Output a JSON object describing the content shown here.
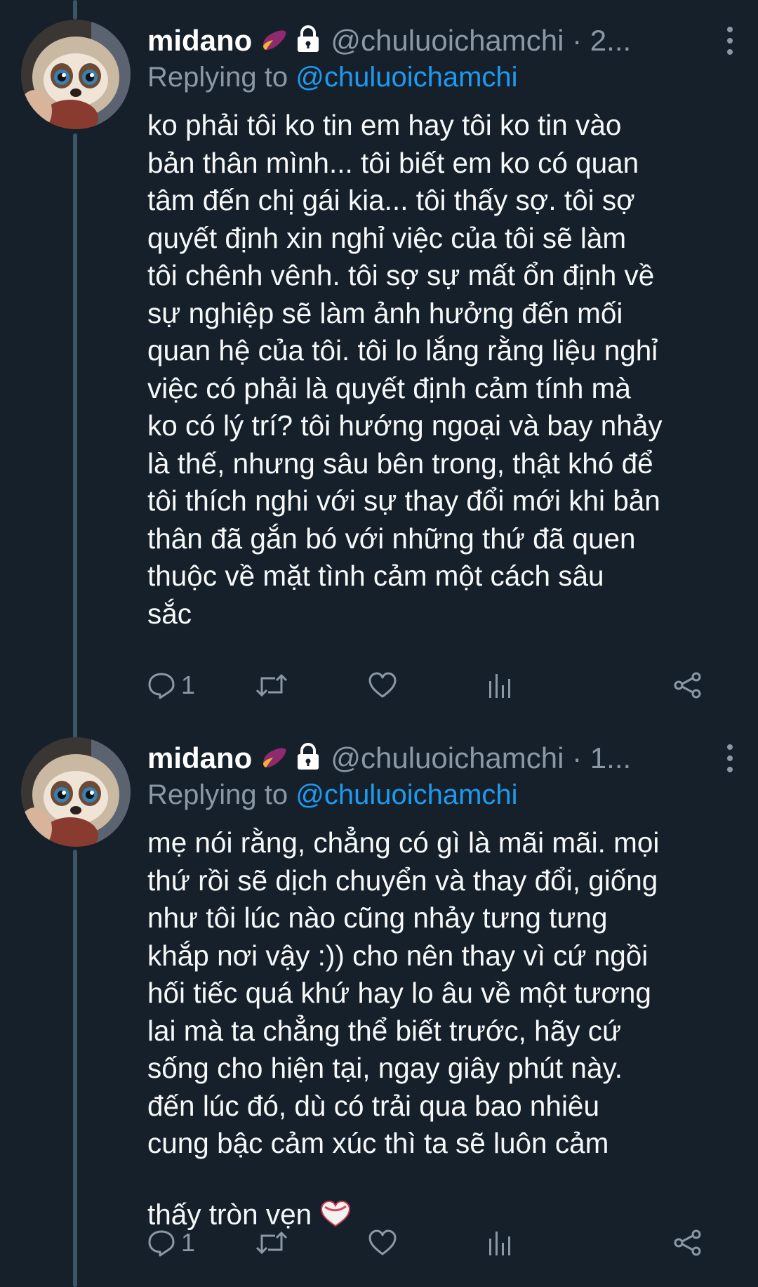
{
  "tweets": [
    {
      "name": "midano",
      "handle_time": "@chuluoichamchi · 2...",
      "replying_prefix": "Replying to ",
      "replying_to": "@chuluoichamchi",
      "text": "ko phải tôi ko tin em hay tôi ko tin vào\nbản thân mình... tôi biết em ko có quan\ntâm đến chị gái kia... tôi thấy sợ. tôi sợ\nquyết định xin nghỉ việc của tôi sẽ làm\ntôi chênh vênh. tôi sợ sự mất ổn định về\nsự nghiệp sẽ làm ảnh hưởng đến mối\nquan hệ của tôi. tôi lo lắng rằng liệu nghỉ\nviệc có phải là quyết định cảm tính mà\nko có lý trí? tôi hướng ngoại và bay nhảy\nlà thế, nhưng sâu bên trong, thật khó để\ntôi thích nghi với sự thay đổi mới khi bản\nthân đã gắn bó với những thứ đã quen\nthuộc về mặt tình cảm một cách sâu\nsắc",
      "reply_count": "1"
    },
    {
      "name": "midano",
      "handle_time": "@chuluoichamchi · 1...",
      "replying_prefix": "Replying to ",
      "replying_to": "@chuluoichamchi",
      "text": "mẹ nói rằng, chẳng có gì là mãi mãi. mọi\nthứ rồi sẽ dịch chuyển và thay đổi, giống\nnhư tôi lúc nào cũng nhảy tưng tưng\nkhắp nơi vậy :)) cho nên thay vì cứ ngồi\nhối tiếc quá khứ hay lo âu về một tương\nlai mà ta chẳng thể biết trước, hãy cứ\nsống cho hiện tại, ngay giây phút này.\nđến lúc đó, dù có trải qua bao nhiêu\ncung bậc cảm xúc thì ta sẽ luôn cảm\nthấy tròn vẹn",
      "reply_count": "1"
    }
  ],
  "icons": {
    "emoji": "sweet-potato-emoji",
    "lock": "lock-icon",
    "more": "more-vertical-icon",
    "reply": "reply-icon",
    "retweet": "retweet-icon",
    "like": "heart-icon",
    "analytics": "analytics-icon",
    "share": "share-icon",
    "heart_emoji": "white-heart-emoji"
  },
  "colors": {
    "background": "#15202b",
    "text": "#f7f9f9",
    "secondary": "#8b98a5",
    "link": "#1d9bf0",
    "thread_line": "#3d5466"
  }
}
